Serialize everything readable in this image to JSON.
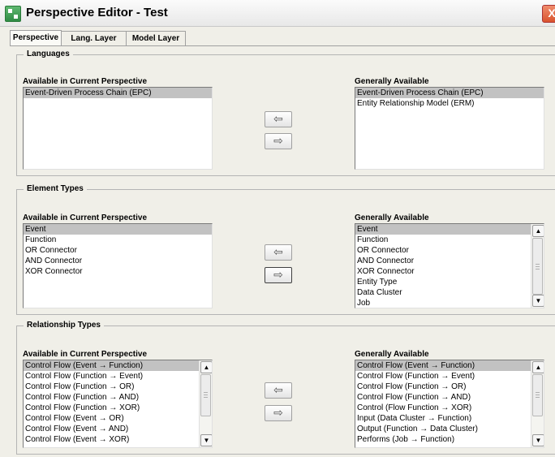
{
  "window": {
    "title": "Perspective Editor - Test",
    "close_glyph": "X"
  },
  "tabs": [
    {
      "label": "Perspective"
    },
    {
      "label": "Lang. Layer"
    },
    {
      "label": "Model Layer"
    }
  ],
  "arrows": {
    "left": "⇦",
    "right": "⇨"
  },
  "languages": {
    "legend": "Languages",
    "available_label": "Available in Current Perspective",
    "available_items": [
      "Event-Driven Process Chain (EPC)"
    ],
    "general_label": "Generally Available",
    "general_items": [
      "Event-Driven Process Chain (EPC)",
      "Entity Relationship Model (ERM)"
    ]
  },
  "element_types": {
    "legend": "Element Types",
    "available_label": "Available in Current Perspective",
    "available_items": [
      "Event",
      "Function",
      "OR Connector",
      "AND Connector",
      "XOR Connector"
    ],
    "general_label": "Generally Available",
    "general_items": [
      "Event",
      "Function",
      "OR Connector",
      "AND Connector",
      "XOR Connector",
      "Entity Type",
      "Data Cluster",
      "Job"
    ]
  },
  "relationship_types": {
    "legend": "Relationship Types",
    "available_label": "Available in Current Perspective",
    "available_items": [
      "Control Flow (Event → Function)",
      "Control Flow (Function → Event)",
      "Control Flow (Function → OR)",
      "Control Flow (Function → AND)",
      "Control Flow (Function → XOR)",
      "Control Flow (Event → OR)",
      "Control Flow (Event → AND)",
      "Control Flow (Event → XOR)"
    ],
    "general_label": "Generally Available",
    "general_items": [
      "Control Flow (Event → Function)",
      "Control Flow (Function → Event)",
      "Control Flow (Function → OR)",
      "Control Flow (Function → AND)",
      "Control (Flow Function → XOR)",
      "Input (Data Cluster → Function)",
      "Output (Function → Data Cluster)",
      "Performs (Job → Function)"
    ]
  }
}
